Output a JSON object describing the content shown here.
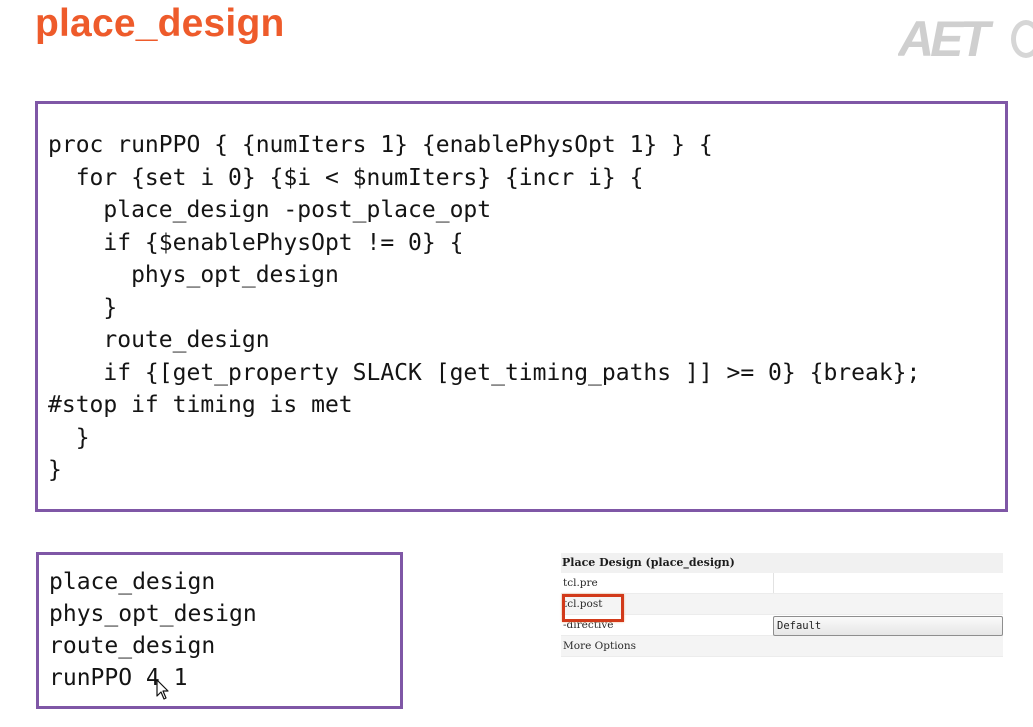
{
  "slide": {
    "title": "place_design",
    "logo_text": "AET"
  },
  "main_code": {
    "lines": [
      "proc runPPO { {numIters 1} {enablePhysOpt 1} } {",
      "  for {set i 0} {$i < $numIters} {incr i} {",
      "    place_design -post_place_opt",
      "    if {$enablePhysOpt != 0} {",
      "      phys_opt_design",
      "    }",
      "    route_design",
      "    if {[get_property SLACK [get_timing_paths ]] >= 0} {break};",
      "#stop if timing is met",
      "  }",
      "}"
    ]
  },
  "command_code": {
    "lines": [
      "place_design",
      "phys_opt_design",
      "route_design",
      "runPPO 4 1"
    ]
  },
  "settings": {
    "header": "Place Design (place_design)",
    "rows": [
      {
        "label": "tcl.pre",
        "value": ""
      },
      {
        "label": "tcl.post",
        "value": ""
      },
      {
        "label": "-directive",
        "value": "Default"
      },
      {
        "label": "More Options",
        "value": ""
      }
    ]
  },
  "colors": {
    "title": "#ee5b2b",
    "box_border": "#7f57a6",
    "highlight": "#d23a1a"
  },
  "icons": {
    "cursor": "mouse-pointer-icon",
    "logo": "aet-logo-icon"
  }
}
